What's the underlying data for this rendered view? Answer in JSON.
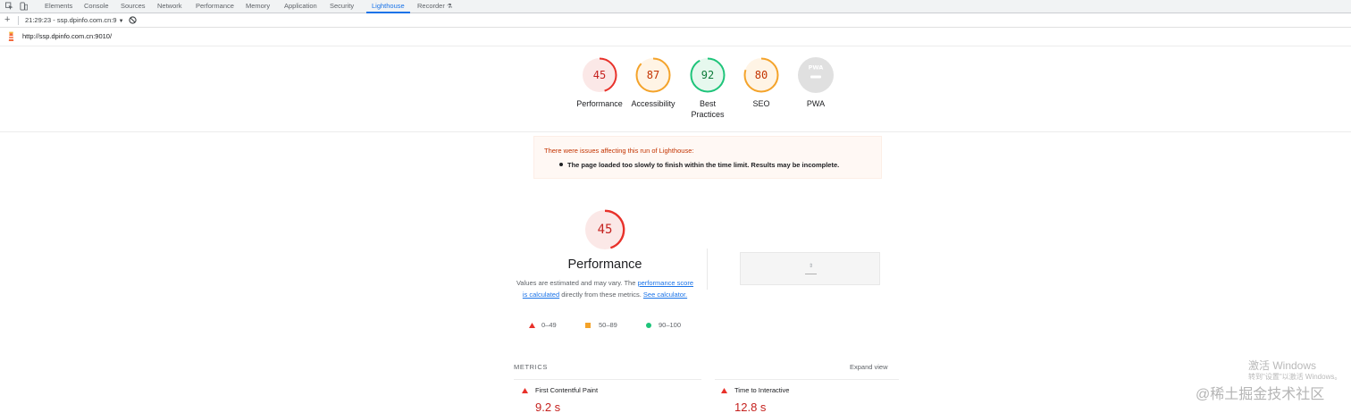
{
  "devtools": {
    "tabs": [
      "Elements",
      "Console",
      "Sources",
      "Network",
      "Performance",
      "Memory",
      "Application",
      "Security",
      "Lighthouse",
      "Recorder"
    ],
    "active_tab": "Lighthouse",
    "report_selector": "21:29:23 - ssp.dpinfo.com.cn:9",
    "new_report_label": "+"
  },
  "url": "http://ssp.dpinfo.com.cn:9010/",
  "gauges": [
    {
      "label": "Performance",
      "score": 45,
      "color": "#e8312a",
      "bg": "#fbe8e7",
      "text_color": "#c5221f"
    },
    {
      "label": "Accessibility",
      "score": 87,
      "color": "#f4a32a",
      "bg": "#fff4e5",
      "text_color": "#c33300"
    },
    {
      "label": "Best Practices",
      "score": 92,
      "color": "#1ec47a",
      "bg": "#e6f8ee",
      "text_color": "#0d7b3a"
    },
    {
      "label": "SEO",
      "score": 80,
      "color": "#f4a32a",
      "bg": "#fff4e5",
      "text_color": "#c33300"
    },
    {
      "label": "PWA",
      "badge": "PWA",
      "bg": "#e0e0e0"
    }
  ],
  "warning": {
    "title": "There were issues affecting this run of Lighthouse:",
    "items": [
      "The page loaded too slowly to finish within the time limit. Results may be incomplete."
    ]
  },
  "performance": {
    "score": 45,
    "title": "Performance",
    "desc_1": "Values are estimated and may vary. The ",
    "link_1": "performance score is calculated",
    "desc_2": " directly from these metrics. ",
    "link_2": "See calculator."
  },
  "legend": [
    {
      "range": "0–49",
      "color": "#e8312a",
      "shape": "triangle"
    },
    {
      "range": "50–89",
      "color": "#f4a32a",
      "shape": "square"
    },
    {
      "range": "90–100",
      "color": "#1ec47a",
      "shape": "circle"
    }
  ],
  "metrics": {
    "heading": "METRICS",
    "expand": "Expand view",
    "items": [
      {
        "name": "First Contentful Paint",
        "value": "9.2 s",
        "status_color": "#e8312a"
      },
      {
        "name": "Time to Interactive",
        "value": "12.8 s",
        "status_color": "#e8312a"
      }
    ]
  },
  "watermarks": {
    "activate_title": "激活 Windows",
    "activate_sub": "转到\"设置\"以激活 Windows。",
    "brand": "@稀土掘金技术社区"
  }
}
